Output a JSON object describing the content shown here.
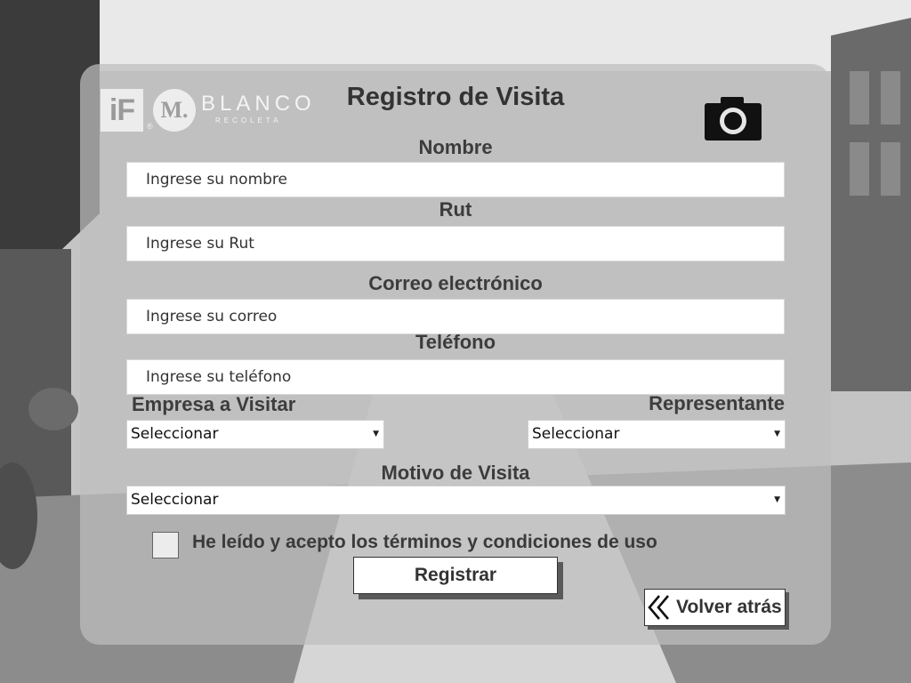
{
  "brand": {
    "if_logo": "iF",
    "registered_mark": "®",
    "name": "BLANCO",
    "sub": "RECOLETA",
    "m_logo": "M."
  },
  "form": {
    "title": "Registro de Visita",
    "camera_icon": "camera-icon",
    "fields": {
      "nombre": {
        "label": "Nombre",
        "placeholder": "Ingrese su nombre",
        "value": ""
      },
      "rut": {
        "label": "Rut",
        "placeholder": "Ingrese su Rut",
        "value": ""
      },
      "correo": {
        "label": "Correo electrónico",
        "placeholder": "Ingrese su correo",
        "value": ""
      },
      "telefono": {
        "label": "Teléfono",
        "placeholder": "Ingrese su teléfono",
        "value": ""
      }
    },
    "empresa": {
      "label": "Empresa a Visitar",
      "selected": "Seleccionar"
    },
    "representante": {
      "label": "Representante",
      "selected": "Seleccionar"
    },
    "motivo": {
      "label": "Motivo de Visita",
      "selected": "Seleccionar"
    },
    "terms": {
      "label": "He leído y acepto los términos y condiciones de uso",
      "checked": false
    },
    "submit_label": "Registrar",
    "back_label": "Volver atrás"
  },
  "colors": {
    "card_bg": "#bebebe",
    "text": "#333333",
    "shadow": "#5a5a5a"
  }
}
